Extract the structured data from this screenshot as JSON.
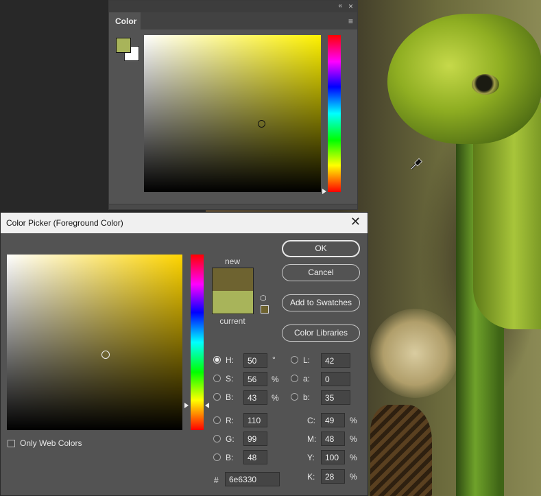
{
  "color_panel": {
    "tab_label": "Color",
    "collapse_glyph": "«",
    "close_glyph": "×",
    "menu_glyph": "≡",
    "foreground_color": "#a8b45a",
    "background_color": "#ffffff"
  },
  "picker": {
    "title": "Color Picker (Foreground Color)",
    "close_glyph": "✕",
    "buttons": {
      "ok": "OK",
      "cancel": "Cancel",
      "add_to_swatches": "Add to Swatches",
      "color_libraries": "Color Libraries"
    },
    "new_label": "new",
    "current_label": "current",
    "new_color": "#6e6330",
    "current_color": "#a8b45a",
    "only_web_colors": {
      "label": "Only Web Colors",
      "checked": false
    },
    "hsb": {
      "h": {
        "label": "H:",
        "value": "50",
        "unit": "°",
        "selected": true
      },
      "s": {
        "label": "S:",
        "value": "56",
        "unit": "%"
      },
      "b": {
        "label": "B:",
        "value": "43",
        "unit": "%"
      }
    },
    "lab": {
      "l": {
        "label": "L:",
        "value": "42"
      },
      "a": {
        "label": "a:",
        "value": "0"
      },
      "b": {
        "label": "b:",
        "value": "35"
      }
    },
    "rgb": {
      "r": {
        "label": "R:",
        "value": "110"
      },
      "g": {
        "label": "G:",
        "value": "99"
      },
      "b": {
        "label": "B:",
        "value": "48"
      }
    },
    "cmyk": {
      "c": {
        "label": "C:",
        "value": "49",
        "unit": "%"
      },
      "m": {
        "label": "M:",
        "value": "48",
        "unit": "%"
      },
      "y": {
        "label": "Y:",
        "value": "100",
        "unit": "%"
      },
      "k": {
        "label": "K:",
        "value": "28",
        "unit": "%"
      }
    },
    "hex": {
      "label": "#",
      "value": "6e6330"
    }
  },
  "icons": {
    "gamut_cube": "cube-icon",
    "eyedropper": "eyedropper-icon"
  }
}
